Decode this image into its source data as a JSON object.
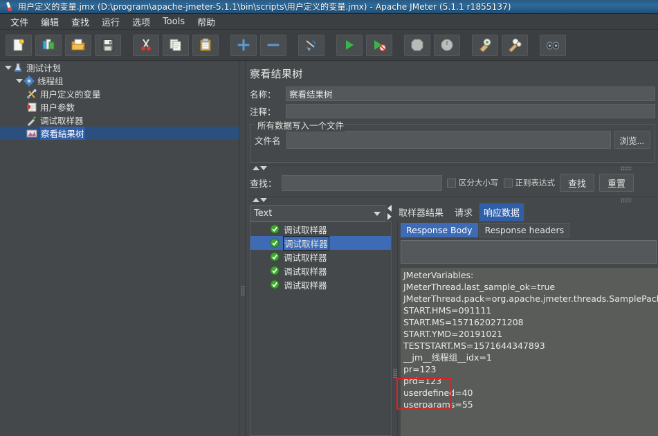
{
  "window": {
    "title": "用户定义的变量.jmx (D:\\program\\apache-jmeter-5.1.1\\bin\\scripts\\用户定义的变量.jmx) - Apache JMeter (5.1.1 r1855137)",
    "icon": "jmeter-flask-icon",
    "accent_selection": "#2f5fa8",
    "accent_tab": "#3d6bb5",
    "annotation_color": "#e02020",
    "background": "#45484a"
  },
  "menubar": {
    "items": [
      {
        "label": "文件",
        "name": "menu-file"
      },
      {
        "label": "编辑",
        "name": "menu-edit"
      },
      {
        "label": "查找",
        "name": "menu-search"
      },
      {
        "label": "运行",
        "name": "menu-run"
      },
      {
        "label": "选项",
        "name": "menu-options"
      },
      {
        "label": "Tools",
        "name": "menu-tools"
      },
      {
        "label": "帮助",
        "name": "menu-help"
      }
    ]
  },
  "toolbar": {
    "buttons": [
      {
        "icon": "new-document-icon",
        "name": "toolbar-new"
      },
      {
        "icon": "templates-icon",
        "name": "toolbar-templates"
      },
      {
        "icon": "open-folder-icon",
        "name": "toolbar-open"
      },
      {
        "icon": "save-floppy-icon",
        "name": "toolbar-save"
      },
      {
        "icon": "cut-scissors-icon",
        "name": "toolbar-cut"
      },
      {
        "icon": "copy-pages-icon",
        "name": "toolbar-copy"
      },
      {
        "icon": "paste-clipboard-icon",
        "name": "toolbar-paste"
      },
      {
        "icon": "plus-icon",
        "name": "toolbar-expand-all"
      },
      {
        "icon": "minus-icon",
        "name": "toolbar-collapse-all"
      },
      {
        "icon": "toggle-icon",
        "name": "toolbar-toggle"
      },
      {
        "icon": "start-play-icon",
        "name": "toolbar-start"
      },
      {
        "icon": "start-no-pauses-icon",
        "name": "toolbar-start-no-pauses"
      },
      {
        "icon": "stop-icon",
        "name": "toolbar-stop"
      },
      {
        "icon": "shutdown-icon",
        "name": "toolbar-shutdown"
      },
      {
        "icon": "clear-icon",
        "name": "toolbar-clear"
      },
      {
        "icon": "clear-all-icon",
        "name": "toolbar-clear-all"
      },
      {
        "icon": "search-binoculars-icon",
        "name": "toolbar-search"
      }
    ]
  },
  "tree": {
    "nodes": [
      {
        "label": "测试计划",
        "icon": "test-plan-icon",
        "indent": 0,
        "twisty": "open",
        "selected": false
      },
      {
        "label": "线程组",
        "icon": "thread-group-icon",
        "indent": 1,
        "twisty": "open",
        "selected": false
      },
      {
        "label": "用户定义的变量",
        "icon": "user-defined-variables-icon",
        "indent": 2,
        "twisty": "none",
        "selected": false
      },
      {
        "label": "用户参数",
        "icon": "user-parameters-icon",
        "indent": 2,
        "twisty": "none",
        "selected": false
      },
      {
        "label": "调试取样器",
        "icon": "debug-sampler-icon",
        "indent": 2,
        "twisty": "none",
        "selected": false
      },
      {
        "label": "察看结果树",
        "icon": "view-results-tree-icon",
        "indent": 2,
        "twisty": "none",
        "selected": true
      }
    ]
  },
  "panel": {
    "title": "察看结果树",
    "name_label": "名称：",
    "name_value": "察看结果树",
    "comment_label": "注释：",
    "comment_value": "",
    "group_title": "所有数据写入一个文件",
    "file_label": "文件名",
    "file_value": "",
    "browse_label": "浏览..."
  },
  "search": {
    "label": "查找：",
    "value": "",
    "case_sensitive_label": "区分大小写",
    "case_sensitive_checked": false,
    "regex_label": "正则表达式",
    "regex_checked": false,
    "find_button": "查找",
    "reset_button": "重置"
  },
  "render_combo": {
    "selected": "Text"
  },
  "result_tabs": [
    {
      "label": "取样器结果",
      "active": false,
      "name": "tab-sampler-result"
    },
    {
      "label": "请求",
      "active": false,
      "name": "tab-request"
    },
    {
      "label": "响应数据",
      "active": true,
      "name": "tab-response-data"
    }
  ],
  "sampler_list": [
    {
      "label": "调试取样器",
      "status": "ok",
      "selected": false
    },
    {
      "label": "调试取样器",
      "status": "ok",
      "selected": true
    },
    {
      "label": "调试取样器",
      "status": "ok",
      "selected": false
    },
    {
      "label": "调试取样器",
      "status": "ok",
      "selected": false
    },
    {
      "label": "调试取样器",
      "status": "ok",
      "selected": false
    }
  ],
  "response_tabs": [
    {
      "label": "Response Body",
      "active": true,
      "name": "tab-response-body"
    },
    {
      "label": "Response headers",
      "active": false,
      "name": "tab-response-headers"
    }
  ],
  "response_body": {
    "find_value": "",
    "lines": [
      "JMeterVariables:",
      "JMeterThread.last_sample_ok=true",
      "JMeterThread.pack=org.apache.jmeter.threads.SamplePackage@",
      "START.HMS=091111",
      "START.MS=1571620271208",
      "START.YMD=20191021",
      "TESTSTART.MS=1571644347893",
      "__jm__线程组__idx=1",
      "pr=123",
      "prd=123",
      "userdefined=40",
      "userparams=55"
    ]
  }
}
